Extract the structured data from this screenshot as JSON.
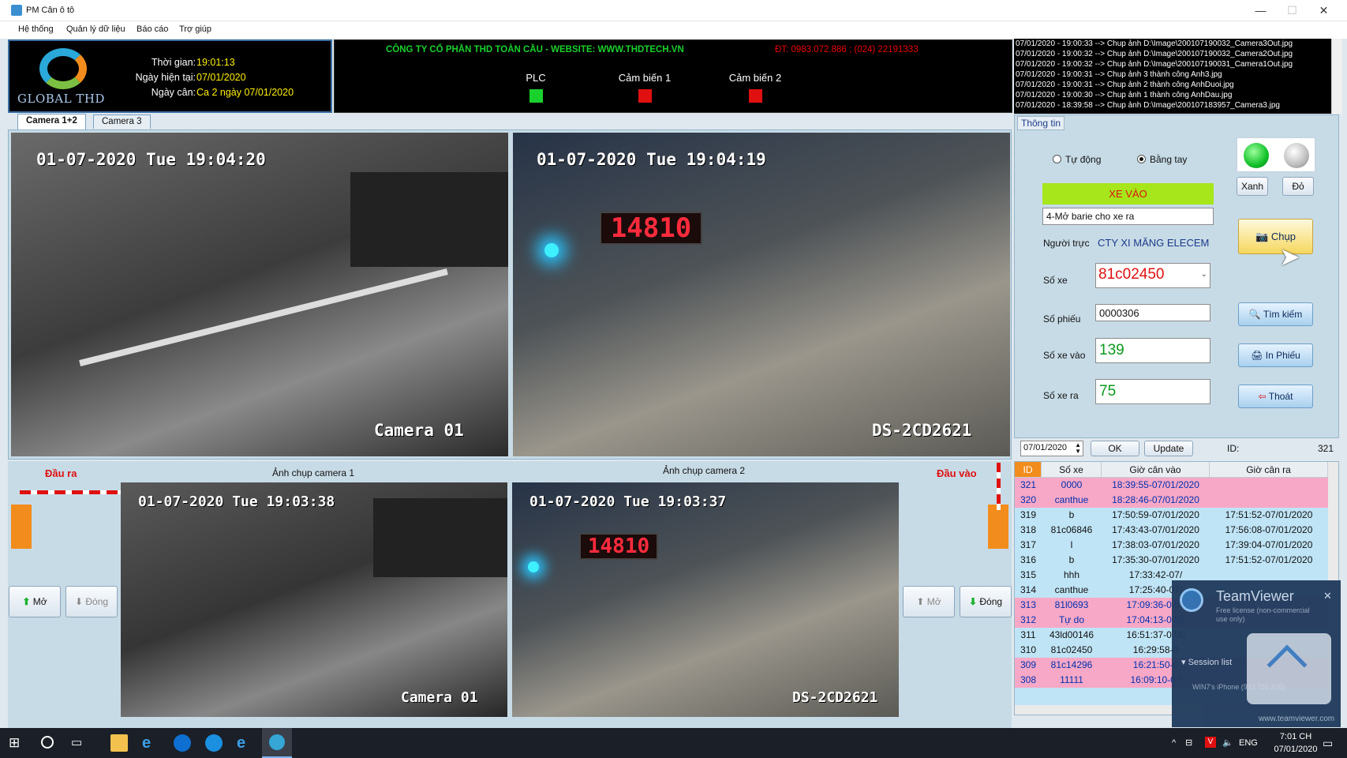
{
  "window": {
    "title": "PM Cân ô tô",
    "minimize": "—",
    "maximize": "☐",
    "close": "✕"
  },
  "menu": [
    "Hệ thống",
    "Quản lý dữ liệu",
    "Báo cáo",
    "Trợ giúp"
  ],
  "header": {
    "logo_text": "GLOBAL THD",
    "time_label": "Thời gian:",
    "time_value": "19:01:13",
    "date_label": "Ngày hiện tại:",
    "date_value": "07/01/2020",
    "shift_label": "Ngày cân:",
    "shift_value": "Ca 2 ngày 07/01/2020",
    "company": "CÔNG TY CỔ PHẦN THD TOÀN CẦU - WEBSITE: WWW.THDTECH.VN",
    "phone": "ĐT: 0983.072.886 ; (024) 22191333",
    "indicators": [
      {
        "label": "PLC",
        "color": "#19d12c"
      },
      {
        "label": "Cảm biến 1",
        "color": "#e01010"
      },
      {
        "label": "Cảm biến 2",
        "color": "#e01010"
      }
    ]
  },
  "log": [
    "07/01/2020 - 19:00:33 --> Chup ảnh D:\\Image\\200107190032_Camera3Out.jpg",
    "07/01/2020 - 19:00:32 --> Chup ảnh D:\\Image\\200107190032_Camera2Out.jpg",
    "07/01/2020 - 19:00:32 --> Chup ảnh D:\\Image\\200107190031_Camera1Out.jpg",
    "07/01/2020 - 19:00:31 --> Chup ảnh 3 thành công Anh3.jpg",
    "07/01/2020 - 19:00:31 --> Chup ảnh 2 thành công AnhDuoi.jpg",
    "07/01/2020 - 19:00:30 --> Chup ảnh 1 thành công AnhDau.jpg",
    "07/01/2020 - 18:39:58 --> Chup ảnh D:\\Image\\200107183957_Camera3.jpg"
  ],
  "tabs": [
    "Camera 1+2",
    "Camera 3"
  ],
  "cameras": {
    "live1": {
      "timestamp": "01-07-2020 Tue 19:04:20",
      "name": "Camera 01"
    },
    "live2": {
      "timestamp": "01-07-2020 Tue 19:04:19",
      "name": "DS-2CD2621",
      "sign": "14810"
    },
    "snap1_title": "Ảnh chụp camera 1",
    "snap2_title": "Ảnh chụp camera 2",
    "snap1": {
      "timestamp": "01-07-2020 Tue 19:03:38",
      "name": "Camera 01"
    },
    "snap2": {
      "timestamp": "01-07-2020 Tue 19:03:37",
      "name": "DS-2CD2621",
      "sign": "14810"
    }
  },
  "barriers": {
    "out_label": "Đầu ra",
    "in_label": "Đầu vào",
    "open": "Mở",
    "close": "Đóng"
  },
  "info": {
    "group_title": "Thông tin",
    "auto": "Tự động",
    "manual": "Bằng tay",
    "mode_selected": "manual",
    "green": "Xanh",
    "red": "Đỏ",
    "status": "XE VÀO",
    "message": "4-Mở barie cho xe ra",
    "operator_label": "Người trực",
    "operator_value": "CTY XI MĂNG ELECEM",
    "plate_label": "Số xe",
    "plate_value": "81c02450",
    "ticket_label": "Số phiếu",
    "ticket_value": "0000306",
    "in_label": "Số xe vào",
    "in_value": "139",
    "out_label": "Số xe ra",
    "out_value": "75",
    "capture": "Chụp",
    "search": "Tìm kiếm",
    "print": "In Phiếu",
    "exit": "Thoát"
  },
  "filter": {
    "date": "07/01/2020",
    "ok": "OK",
    "update": "Update",
    "id_label": "ID:",
    "id_value": "321"
  },
  "table": {
    "headers": [
      "ID",
      "Số xe",
      "Giờ cân vào",
      "Giờ cân ra"
    ],
    "rows": [
      {
        "id": "321",
        "plate": "0000",
        "in": "18:39:55-07/01/2020",
        "out": "",
        "pink": true
      },
      {
        "id": "320",
        "plate": "canthue",
        "in": "18:28:46-07/01/2020",
        "out": "",
        "pink": true
      },
      {
        "id": "319",
        "plate": "b",
        "in": "17:50:59-07/01/2020",
        "out": "17:51:52-07/01/2020",
        "pink": false
      },
      {
        "id": "318",
        "plate": "81c06846",
        "in": "17:43:43-07/01/2020",
        "out": "17:56:08-07/01/2020",
        "pink": false
      },
      {
        "id": "317",
        "plate": "l",
        "in": "17:38:03-07/01/2020",
        "out": "17:39:04-07/01/2020",
        "pink": false
      },
      {
        "id": "316",
        "plate": "b",
        "in": "17:35:30-07/01/2020",
        "out": "17:51:52-07/01/2020",
        "pink": false
      },
      {
        "id": "315",
        "plate": "hhh",
        "in": "17:33:42-07/",
        "out": "",
        "pink": false
      },
      {
        "id": "314",
        "plate": "canthue",
        "in": "17:25:40-07/",
        "out": "",
        "pink": false
      },
      {
        "id": "313",
        "plate": "81l0693",
        "in": "17:09:36-07/0",
        "out": "",
        "pink": true
      },
      {
        "id": "312",
        "plate": "Tự do",
        "in": "17:04:13-07/0",
        "out": "",
        "pink": true
      },
      {
        "id": "311",
        "plate": "43ld00146",
        "in": "16:51:37-07/0",
        "out": "",
        "pink": false
      },
      {
        "id": "310",
        "plate": "81c02450",
        "in": "16:29:58-0",
        "out": "",
        "pink": false
      },
      {
        "id": "309",
        "plate": "81c14296",
        "in": "16:21:50-0",
        "out": "",
        "pink": true
      },
      {
        "id": "308",
        "plate": "11111",
        "in": "16:09:10-07",
        "out": "",
        "pink": true
      }
    ]
  },
  "teamviewer": {
    "title": "TeamViewer",
    "sub1": "Free license (non-commercial",
    "sub2": "use only)",
    "session": "Session list",
    "device": "WIN7's iPhone (933 755 835)",
    "link": "www.teamviewer.com"
  },
  "taskbar": {
    "lang": "ENG",
    "time": "7:01 CH",
    "date": "07/01/2020"
  }
}
